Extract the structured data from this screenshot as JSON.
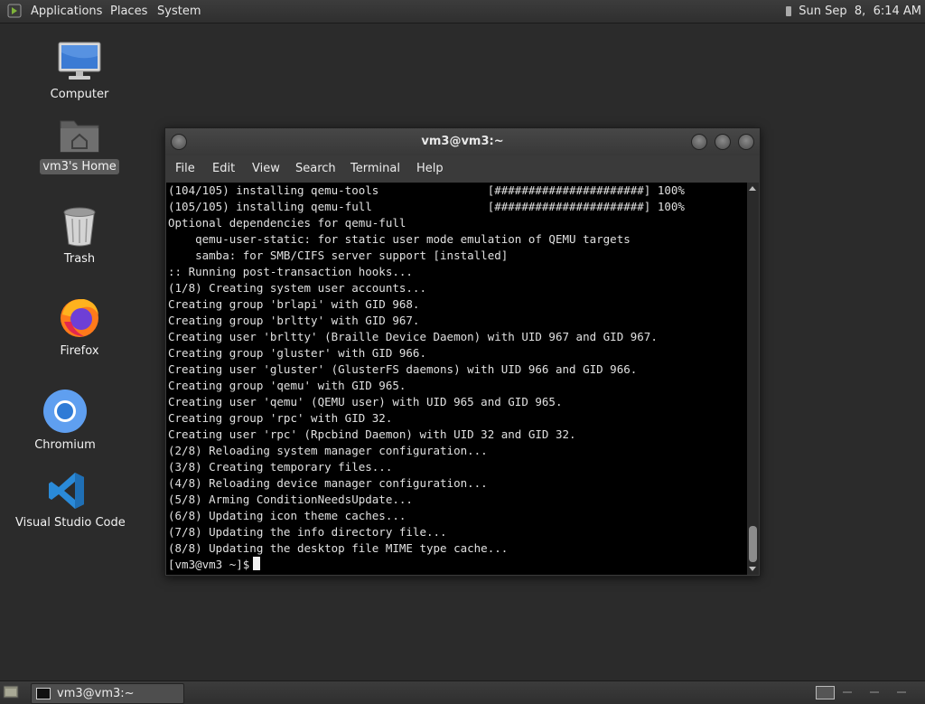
{
  "top_panel": {
    "menus": [
      "Applications",
      "Places",
      "System"
    ],
    "clock": "Sun Sep  8,  6:14 AM"
  },
  "desktop": {
    "icons": [
      {
        "label": "Computer",
        "icon": "monitor-icon"
      },
      {
        "label": "vm3's Home",
        "icon": "home-folder-icon"
      },
      {
        "label": "Trash",
        "icon": "trash-icon"
      },
      {
        "label": "Firefox",
        "icon": "firefox-icon"
      },
      {
        "label": "Chromium",
        "icon": "chromium-icon"
      },
      {
        "label": "Visual Studio Code",
        "icon": "vscode-icon"
      }
    ]
  },
  "terminal": {
    "title": "vm3@vm3:~",
    "menu": [
      "File",
      "Edit",
      "View",
      "Search",
      "Terminal",
      "Help"
    ],
    "lines": [
      "(104/105) installing qemu-tools                [######################] 100%",
      "(105/105) installing qemu-full                 [######################] 100%",
      "Optional dependencies for qemu-full",
      "    qemu-user-static: for static user mode emulation of QEMU targets",
      "    samba: for SMB/CIFS server support [installed]",
      ":: Running post-transaction hooks...",
      "(1/8) Creating system user accounts...",
      "Creating group 'brlapi' with GID 968.",
      "Creating group 'brltty' with GID 967.",
      "Creating user 'brltty' (Braille Device Daemon) with UID 967 and GID 967.",
      "Creating group 'gluster' with GID 966.",
      "Creating user 'gluster' (GlusterFS daemons) with UID 966 and GID 966.",
      "Creating group 'qemu' with GID 965.",
      "Creating user 'qemu' (QEMU user) with UID 965 and GID 965.",
      "Creating group 'rpc' with GID 32.",
      "Creating user 'rpc' (Rpcbind Daemon) with UID 32 and GID 32.",
      "(2/8) Reloading system manager configuration...",
      "(3/8) Creating temporary files...",
      "(4/8) Reloading device manager configuration...",
      "(5/8) Arming ConditionNeedsUpdate...",
      "(6/8) Updating icon theme caches...",
      "(7/8) Updating the info directory file...",
      "(8/8) Updating the desktop file MIME type cache..."
    ],
    "prompt": "[vm3@vm3 ~]$"
  },
  "taskbar": {
    "task_label": "vm3@vm3:~"
  }
}
